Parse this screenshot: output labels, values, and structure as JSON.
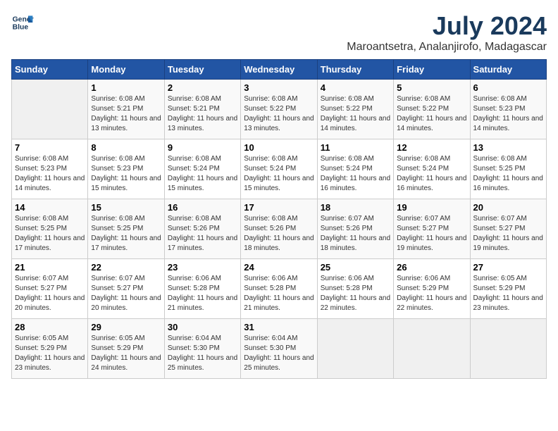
{
  "header": {
    "logo_line1": "General",
    "logo_line2": "Blue",
    "month": "July 2024",
    "location": "Maroantsetra, Analanjirofo, Madagascar"
  },
  "weekdays": [
    "Sunday",
    "Monday",
    "Tuesday",
    "Wednesday",
    "Thursday",
    "Friday",
    "Saturday"
  ],
  "weeks": [
    [
      {
        "day": "",
        "sunrise": "",
        "sunset": "",
        "daylight": ""
      },
      {
        "day": "1",
        "sunrise": "Sunrise: 6:08 AM",
        "sunset": "Sunset: 5:21 PM",
        "daylight": "Daylight: 11 hours and 13 minutes."
      },
      {
        "day": "2",
        "sunrise": "Sunrise: 6:08 AM",
        "sunset": "Sunset: 5:21 PM",
        "daylight": "Daylight: 11 hours and 13 minutes."
      },
      {
        "day": "3",
        "sunrise": "Sunrise: 6:08 AM",
        "sunset": "Sunset: 5:22 PM",
        "daylight": "Daylight: 11 hours and 13 minutes."
      },
      {
        "day": "4",
        "sunrise": "Sunrise: 6:08 AM",
        "sunset": "Sunset: 5:22 PM",
        "daylight": "Daylight: 11 hours and 14 minutes."
      },
      {
        "day": "5",
        "sunrise": "Sunrise: 6:08 AM",
        "sunset": "Sunset: 5:22 PM",
        "daylight": "Daylight: 11 hours and 14 minutes."
      },
      {
        "day": "6",
        "sunrise": "Sunrise: 6:08 AM",
        "sunset": "Sunset: 5:23 PM",
        "daylight": "Daylight: 11 hours and 14 minutes."
      }
    ],
    [
      {
        "day": "7",
        "sunrise": "Sunrise: 6:08 AM",
        "sunset": "Sunset: 5:23 PM",
        "daylight": "Daylight: 11 hours and 14 minutes."
      },
      {
        "day": "8",
        "sunrise": "Sunrise: 6:08 AM",
        "sunset": "Sunset: 5:23 PM",
        "daylight": "Daylight: 11 hours and 15 minutes."
      },
      {
        "day": "9",
        "sunrise": "Sunrise: 6:08 AM",
        "sunset": "Sunset: 5:24 PM",
        "daylight": "Daylight: 11 hours and 15 minutes."
      },
      {
        "day": "10",
        "sunrise": "Sunrise: 6:08 AM",
        "sunset": "Sunset: 5:24 PM",
        "daylight": "Daylight: 11 hours and 15 minutes."
      },
      {
        "day": "11",
        "sunrise": "Sunrise: 6:08 AM",
        "sunset": "Sunset: 5:24 PM",
        "daylight": "Daylight: 11 hours and 16 minutes."
      },
      {
        "day": "12",
        "sunrise": "Sunrise: 6:08 AM",
        "sunset": "Sunset: 5:24 PM",
        "daylight": "Daylight: 11 hours and 16 minutes."
      },
      {
        "day": "13",
        "sunrise": "Sunrise: 6:08 AM",
        "sunset": "Sunset: 5:25 PM",
        "daylight": "Daylight: 11 hours and 16 minutes."
      }
    ],
    [
      {
        "day": "14",
        "sunrise": "Sunrise: 6:08 AM",
        "sunset": "Sunset: 5:25 PM",
        "daylight": "Daylight: 11 hours and 17 minutes."
      },
      {
        "day": "15",
        "sunrise": "Sunrise: 6:08 AM",
        "sunset": "Sunset: 5:25 PM",
        "daylight": "Daylight: 11 hours and 17 minutes."
      },
      {
        "day": "16",
        "sunrise": "Sunrise: 6:08 AM",
        "sunset": "Sunset: 5:26 PM",
        "daylight": "Daylight: 11 hours and 17 minutes."
      },
      {
        "day": "17",
        "sunrise": "Sunrise: 6:08 AM",
        "sunset": "Sunset: 5:26 PM",
        "daylight": "Daylight: 11 hours and 18 minutes."
      },
      {
        "day": "18",
        "sunrise": "Sunrise: 6:07 AM",
        "sunset": "Sunset: 5:26 PM",
        "daylight": "Daylight: 11 hours and 18 minutes."
      },
      {
        "day": "19",
        "sunrise": "Sunrise: 6:07 AM",
        "sunset": "Sunset: 5:27 PM",
        "daylight": "Daylight: 11 hours and 19 minutes."
      },
      {
        "day": "20",
        "sunrise": "Sunrise: 6:07 AM",
        "sunset": "Sunset: 5:27 PM",
        "daylight": "Daylight: 11 hours and 19 minutes."
      }
    ],
    [
      {
        "day": "21",
        "sunrise": "Sunrise: 6:07 AM",
        "sunset": "Sunset: 5:27 PM",
        "daylight": "Daylight: 11 hours and 20 minutes."
      },
      {
        "day": "22",
        "sunrise": "Sunrise: 6:07 AM",
        "sunset": "Sunset: 5:27 PM",
        "daylight": "Daylight: 11 hours and 20 minutes."
      },
      {
        "day": "23",
        "sunrise": "Sunrise: 6:06 AM",
        "sunset": "Sunset: 5:28 PM",
        "daylight": "Daylight: 11 hours and 21 minutes."
      },
      {
        "day": "24",
        "sunrise": "Sunrise: 6:06 AM",
        "sunset": "Sunset: 5:28 PM",
        "daylight": "Daylight: 11 hours and 21 minutes."
      },
      {
        "day": "25",
        "sunrise": "Sunrise: 6:06 AM",
        "sunset": "Sunset: 5:28 PM",
        "daylight": "Daylight: 11 hours and 22 minutes."
      },
      {
        "day": "26",
        "sunrise": "Sunrise: 6:06 AM",
        "sunset": "Sunset: 5:29 PM",
        "daylight": "Daylight: 11 hours and 22 minutes."
      },
      {
        "day": "27",
        "sunrise": "Sunrise: 6:05 AM",
        "sunset": "Sunset: 5:29 PM",
        "daylight": "Daylight: 11 hours and 23 minutes."
      }
    ],
    [
      {
        "day": "28",
        "sunrise": "Sunrise: 6:05 AM",
        "sunset": "Sunset: 5:29 PM",
        "daylight": "Daylight: 11 hours and 23 minutes."
      },
      {
        "day": "29",
        "sunrise": "Sunrise: 6:05 AM",
        "sunset": "Sunset: 5:29 PM",
        "daylight": "Daylight: 11 hours and 24 minutes."
      },
      {
        "day": "30",
        "sunrise": "Sunrise: 6:04 AM",
        "sunset": "Sunset: 5:30 PM",
        "daylight": "Daylight: 11 hours and 25 minutes."
      },
      {
        "day": "31",
        "sunrise": "Sunrise: 6:04 AM",
        "sunset": "Sunset: 5:30 PM",
        "daylight": "Daylight: 11 hours and 25 minutes."
      },
      {
        "day": "",
        "sunrise": "",
        "sunset": "",
        "daylight": ""
      },
      {
        "day": "",
        "sunrise": "",
        "sunset": "",
        "daylight": ""
      },
      {
        "day": "",
        "sunrise": "",
        "sunset": "",
        "daylight": ""
      }
    ]
  ]
}
